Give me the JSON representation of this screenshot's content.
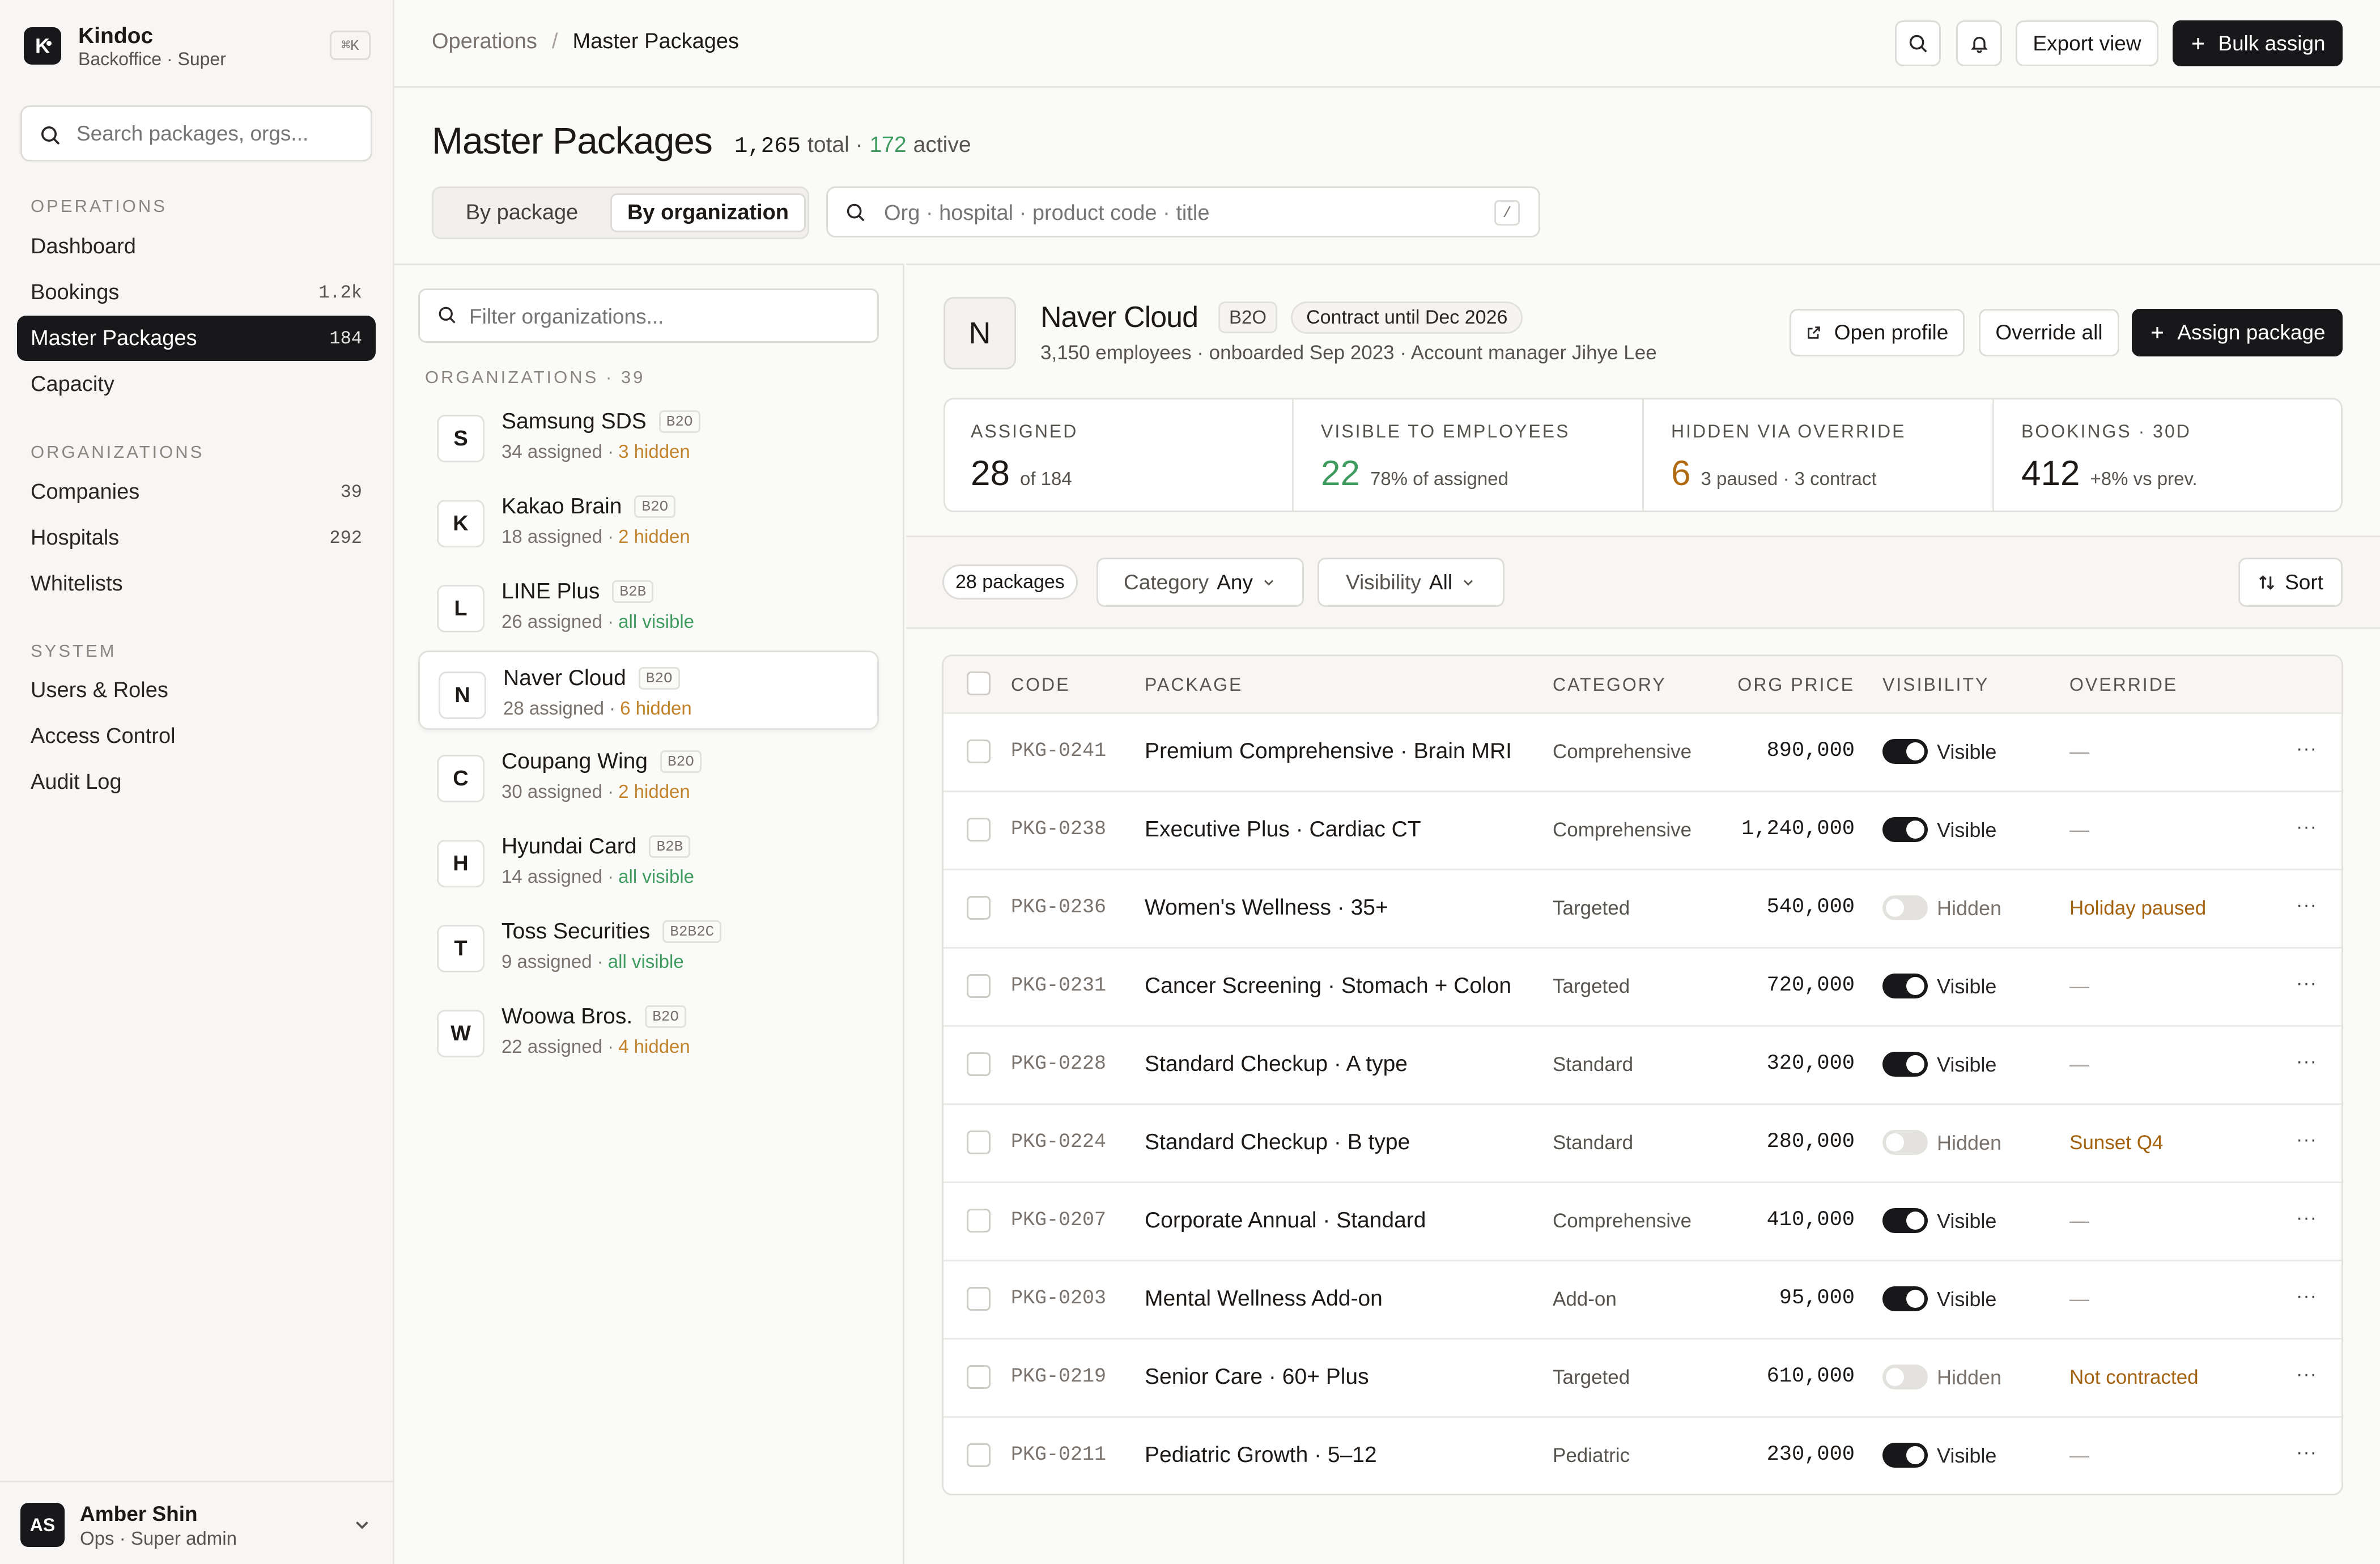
{
  "app": {
    "name": "Kindoc",
    "subtitle": "Backoffice · Super",
    "shortcut": "⌘K",
    "logo_letter": "K"
  },
  "sidebar": {
    "search_placeholder": "Search packages, orgs...",
    "sections": [
      {
        "label": "OPERATIONS",
        "items": [
          {
            "label": "Dashboard",
            "count": ""
          },
          {
            "label": "Bookings",
            "count": "1.2k"
          },
          {
            "label": "Master Packages",
            "count": "184"
          },
          {
            "label": "Capacity",
            "count": ""
          }
        ]
      },
      {
        "label": "ORGANIZATIONS",
        "items": [
          {
            "label": "Companies",
            "count": "39"
          },
          {
            "label": "Hospitals",
            "count": "292"
          },
          {
            "label": "Whitelists",
            "count": ""
          }
        ]
      },
      {
        "label": "SYSTEM",
        "items": [
          {
            "label": "Users & Roles",
            "count": ""
          },
          {
            "label": "Access Control",
            "count": ""
          },
          {
            "label": "Audit Log",
            "count": ""
          }
        ]
      }
    ],
    "user": {
      "initials": "AS",
      "name": "Amber Shin",
      "role": "Ops · Super admin"
    }
  },
  "topbar": {
    "breadcrumb": [
      "Operations",
      "Master Packages"
    ],
    "export_label": "Export view",
    "bulk_label": "Bulk assign"
  },
  "page": {
    "title": "Master Packages",
    "total": "1,265",
    "total_label": "total ·",
    "active": "172",
    "active_label": "active",
    "tabs": [
      "By package",
      "By organization"
    ],
    "search_placeholder": "Org · hospital · product code · title",
    "search_key": "/"
  },
  "orgs": {
    "filter_placeholder": "Filter organizations...",
    "header": "ORGANIZATIONS · 39",
    "items": [
      {
        "letter": "S",
        "name": "Samsung SDS",
        "tag": "B2O",
        "assigned": "34 assigned ·",
        "status": "3 hidden",
        "status_type": "hidden"
      },
      {
        "letter": "K",
        "name": "Kakao Brain",
        "tag": "B2O",
        "assigned": "18 assigned ·",
        "status": "2 hidden",
        "status_type": "hidden"
      },
      {
        "letter": "L",
        "name": "LINE Plus",
        "tag": "B2B",
        "assigned": "26 assigned ·",
        "status": "all visible",
        "status_type": "visible"
      },
      {
        "letter": "N",
        "name": "Naver Cloud",
        "tag": "B2O",
        "assigned": "28 assigned ·",
        "status": "6 hidden",
        "status_type": "hidden"
      },
      {
        "letter": "C",
        "name": "Coupang Wing",
        "tag": "B2O",
        "assigned": "30 assigned ·",
        "status": "2 hidden",
        "status_type": "hidden"
      },
      {
        "letter": "H",
        "name": "Hyundai Card",
        "tag": "B2B",
        "assigned": "14 assigned ·",
        "status": "all visible",
        "status_type": "visible"
      },
      {
        "letter": "T",
        "name": "Toss Securities",
        "tag": "B2B2C",
        "assigned": "9 assigned ·",
        "status": "all visible",
        "status_type": "visible"
      },
      {
        "letter": "W",
        "name": "Woowa Bros.",
        "tag": "B2O",
        "assigned": "22 assigned ·",
        "status": "4 hidden",
        "status_type": "hidden"
      }
    ]
  },
  "detail": {
    "letter": "N",
    "name": "Naver Cloud",
    "tag": "B2O",
    "contract": "Contract until Dec 2026",
    "meta": "3,150 employees · onboarded Sep 2023 · Account manager Jihye Lee",
    "open_profile": "Open profile",
    "override_all": "Override all",
    "assign": "Assign package",
    "stats": [
      {
        "label": "ASSIGNED",
        "value": "28",
        "note": "of 184",
        "color": "#1c1917"
      },
      {
        "label": "VISIBLE TO EMPLOYEES",
        "value": "22",
        "note": "78% of assigned",
        "color": "#3f9b5f"
      },
      {
        "label": "HIDDEN VIA OVERRIDE",
        "value": "6",
        "note": "3 paused · 3 contract",
        "color": "#b06a12"
      },
      {
        "label": "BOOKINGS · 30D",
        "value": "412",
        "note": "+8% vs prev.",
        "color": "#1c1917"
      }
    ],
    "filters": {
      "count": "28 packages",
      "category_label": "Category",
      "category_value": "Any",
      "visibility_label": "Visibility",
      "visibility_value": "All",
      "sort": "Sort"
    },
    "table": {
      "headers": [
        "CODE",
        "PACKAGE",
        "CATEGORY",
        "ORG PRICE",
        "VISIBILITY",
        "OVERRIDE"
      ],
      "rows": [
        {
          "code": "PKG-0241",
          "package": "Premium Comprehensive · Brain MRI",
          "category": "Comprehensive",
          "price": "890,000",
          "visible": true,
          "visibility": "Visible",
          "override": "—"
        },
        {
          "code": "PKG-0238",
          "package": "Executive Plus · Cardiac CT",
          "category": "Comprehensive",
          "price": "1,240,000",
          "visible": true,
          "visibility": "Visible",
          "override": "—"
        },
        {
          "code": "PKG-0236",
          "package": "Women's Wellness · 35+",
          "category": "Targeted",
          "price": "540,000",
          "visible": false,
          "visibility": "Hidden",
          "override": "Holiday paused"
        },
        {
          "code": "PKG-0231",
          "package": "Cancer Screening · Stomach + Colon",
          "category": "Targeted",
          "price": "720,000",
          "visible": true,
          "visibility": "Visible",
          "override": "—"
        },
        {
          "code": "PKG-0228",
          "package": "Standard Checkup · A type",
          "category": "Standard",
          "price": "320,000",
          "visible": true,
          "visibility": "Visible",
          "override": "—"
        },
        {
          "code": "PKG-0224",
          "package": "Standard Checkup · B type",
          "category": "Standard",
          "price": "280,000",
          "visible": false,
          "visibility": "Hidden",
          "override": "Sunset Q4"
        },
        {
          "code": "PKG-0207",
          "package": "Corporate Annual · Standard",
          "category": "Comprehensive",
          "price": "410,000",
          "visible": true,
          "visibility": "Visible",
          "override": "—"
        },
        {
          "code": "PKG-0203",
          "package": "Mental Wellness Add-on",
          "category": "Add-on",
          "price": "95,000",
          "visible": true,
          "visibility": "Visible",
          "override": "—"
        },
        {
          "code": "PKG-0219",
          "package": "Senior Care · 60+ Plus",
          "category": "Targeted",
          "price": "610,000",
          "visible": false,
          "visibility": "Hidden",
          "override": "Not contracted"
        },
        {
          "code": "PKG-0211",
          "package": "Pediatric Growth · 5–12",
          "category": "Pediatric",
          "price": "230,000",
          "visible": true,
          "visibility": "Visible",
          "override": "—"
        }
      ]
    }
  }
}
